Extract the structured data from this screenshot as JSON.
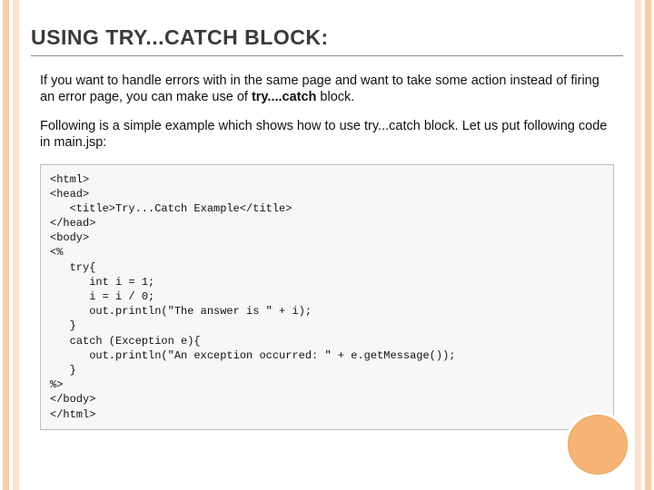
{
  "title": "USING TRY...CATCH BLOCK:",
  "paragraph1": {
    "pre": "If you want to handle errors with in the same page and want to take some action instead of firing an error page, you can make use of ",
    "bold": "try....catch",
    "post": " block."
  },
  "paragraph2": "Following is a simple example which shows how to use try...catch block. Let us put following code in main.jsp:",
  "code": "<html>\n<head>\n   <title>Try...Catch Example</title>\n</head>\n<body>\n<%\n   try{\n      int i = 1;\n      i = i / 0;\n      out.println(\"The answer is \" + i);\n   }\n   catch (Exception e){\n      out.println(\"An exception occurred: \" + e.getMessage());\n   }\n%>\n</body>\n</html>"
}
